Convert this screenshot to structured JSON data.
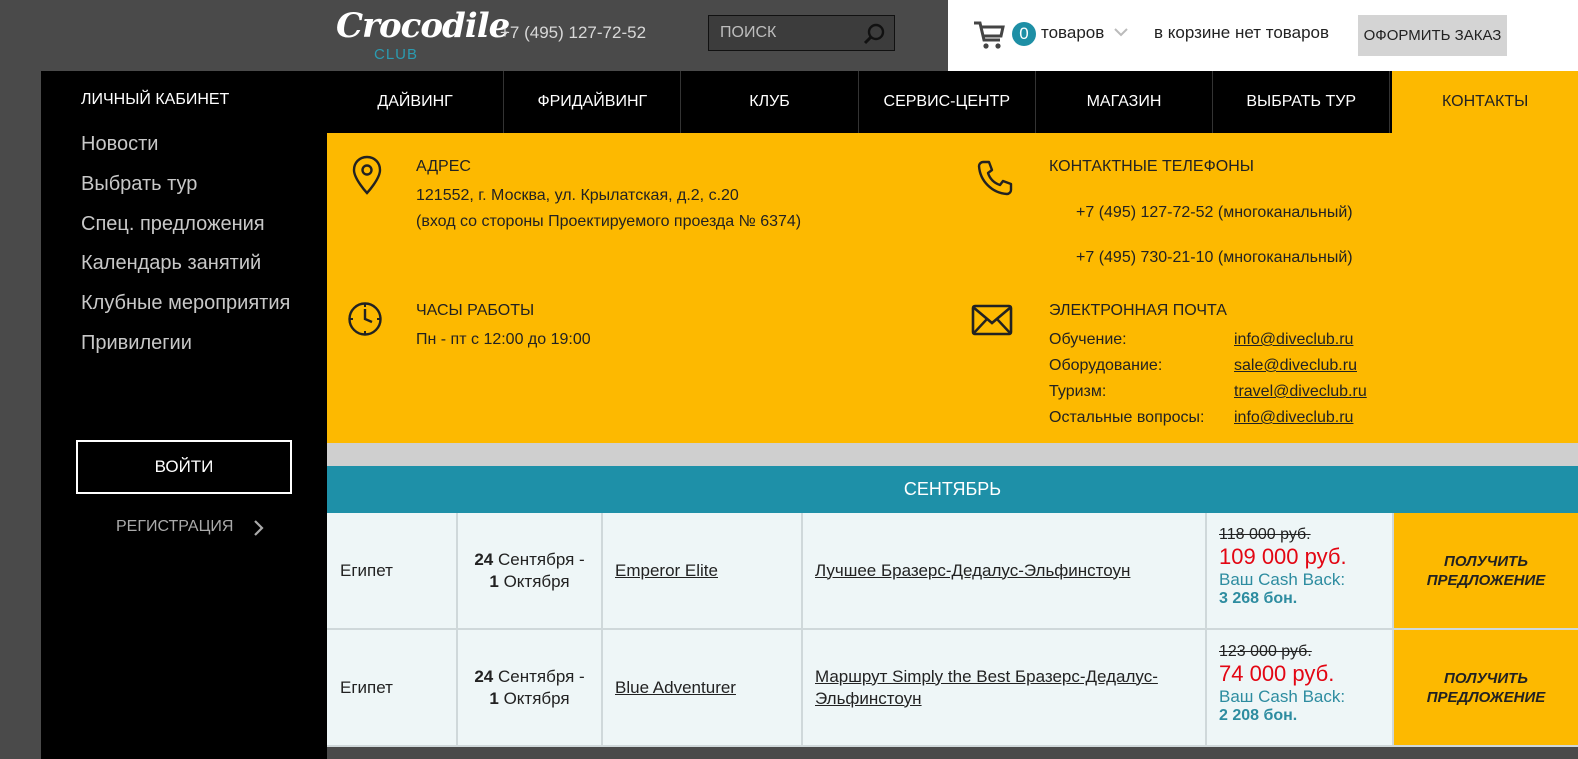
{
  "header": {
    "logo_main": "Crocodile",
    "logo_sub": "CLUB",
    "phone": "+7 (495) 127-72-52",
    "search_placeholder": "ПОИСК",
    "cart_count": "0",
    "cart_label": "товаров",
    "cart_empty": "в корзине нет товаров",
    "order_button": "ОФОРМИТЬ ЗАКАЗ"
  },
  "sidebar": {
    "title": "ЛИЧНЫЙ КАБИНЕТ",
    "items": [
      "Новости",
      "Выбрать тур",
      "Спец. предложения",
      "Календарь занятий",
      "Клубные мероприятия",
      "Привилегии"
    ],
    "login": "ВОЙТИ",
    "register": "РЕГИСТРАЦИЯ"
  },
  "nav": {
    "items": [
      "ДАЙВИНГ",
      "ФРИДАЙВИНГ",
      "КЛУБ",
      "СЕРВИС-ЦЕНТР",
      "МАГАЗИН",
      "ВЫБРАТЬ ТУР",
      "КОНТАКТЫ"
    ],
    "active": "КОНТАКТЫ"
  },
  "contacts": {
    "address_title": "АДРЕС",
    "address_line1": "121552, г. Москва, ул. Крылатская, д.2, с.20",
    "address_line2": "(вход со стороны Проектируемого проезда № 6374)",
    "phones_title": "КОНТАКТНЫЕ ТЕЛЕФОНЫ",
    "phone1": "+7 (495) 127-72-52 (многоканальный)",
    "phone2": "+7 (495) 730-21-10 (многоканальный)",
    "hours_title": "ЧАСЫ РАБОТЫ",
    "hours_text": "Пн - пт с 12:00 до 19:00",
    "email_title": "ЭЛЕКТРОННАЯ ПОЧТА",
    "emails": [
      {
        "label": "Обучение:",
        "address": "info@diveclub.ru"
      },
      {
        "label": "Оборудование:",
        "address": "sale@diveclub.ru"
      },
      {
        "label": "Туризм:",
        "address": "travel@diveclub.ru"
      },
      {
        "label": "Остальные вопросы:",
        "address": "info@diveclub.ru"
      }
    ]
  },
  "tours": {
    "month": "СЕНТЯБРЬ",
    "rows": [
      {
        "country": "Египет",
        "date_start_day": "24",
        "date_start_month": "Сентября -",
        "date_end_day": "1",
        "date_end_month": "Октября",
        "ship": "Emperor Elite",
        "route": "Лучшее Бразерс-Дедалус-Эльфинстоун",
        "old_price": "118 000 руб.",
        "new_price": "109 000 руб.",
        "cashback_label": "Ваш Cash Back:",
        "cashback_value": "3 268 бон.",
        "offer_line1": "ПОЛУЧИТЬ",
        "offer_line2": "ПРЕДЛОЖЕНИЕ"
      },
      {
        "country": "Египет",
        "date_start_day": "24",
        "date_start_month": "Сентября -",
        "date_end_day": "1",
        "date_end_month": "Октября",
        "ship": "Blue Adventurer",
        "route": "Маршрут Simply the Best Бразерс-Дедалус-Эльфинстоун",
        "old_price": "123 000 руб.",
        "new_price": "74 000 руб.",
        "cashback_label": "Ваш Cash Back:",
        "cashback_value": "2 208 бон.",
        "offer_line1": "ПОЛУЧИТЬ",
        "offer_line2": "ПРЕДЛОЖЕНИЕ"
      }
    ]
  },
  "colors": {
    "accent_yellow": "#fdb900",
    "accent_teal": "#1e90a8",
    "price_red": "#e30613"
  }
}
